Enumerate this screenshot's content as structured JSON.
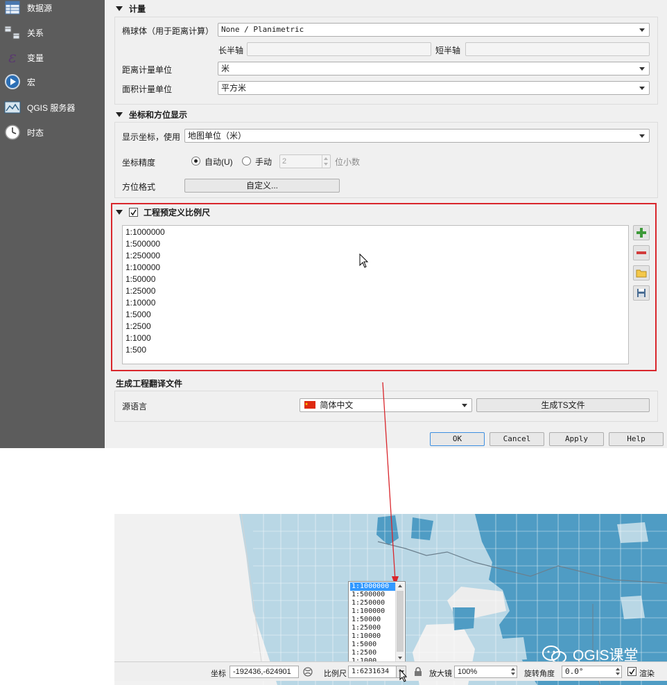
{
  "sidebar": {
    "items": [
      {
        "label": "数据源",
        "icon": "table-icon"
      },
      {
        "label": "关系",
        "icon": "relations-icon"
      },
      {
        "label": "变量",
        "icon": "variable-icon"
      },
      {
        "label": "宏",
        "icon": "macro-icon"
      },
      {
        "label": "QGIS 服务器",
        "icon": "server-icon"
      },
      {
        "label": "时态",
        "icon": "clock-icon"
      }
    ]
  },
  "measurements": {
    "title": "计量",
    "ellipsoid_label": "椭球体（用于距离计算）",
    "ellipsoid_value": "None / Planimetric",
    "semi_major_label": "长半轴",
    "semi_minor_label": "短半轴",
    "distance_units_label": "距离计量单位",
    "distance_units_value": "米",
    "area_units_label": "面积计量单位",
    "area_units_value": "平方米"
  },
  "coordinates": {
    "title": "坐标和方位显示",
    "display_label": "显示坐标，使用",
    "display_value": "地图单位（米）",
    "precision_label": "坐标精度",
    "auto_label": "自动(U)",
    "manual_label": "手动",
    "precision_value": "2",
    "decimals_label": "位小数",
    "bearing_label": "方位格式",
    "bearing_button": "自定义..."
  },
  "scales": {
    "title": "工程预定义比例尺",
    "checked": true,
    "items": [
      "1:1000000",
      "1:500000",
      "1:250000",
      "1:100000",
      "1:50000",
      "1:25000",
      "1:10000",
      "1:5000",
      "1:2500",
      "1:1000",
      "1:500"
    ]
  },
  "translation": {
    "title": "生成工程翻译文件",
    "source_label": "源语言",
    "source_value": "简体中文",
    "generate_button": "生成TS文件"
  },
  "buttons": {
    "ok": "OK",
    "cancel": "Cancel",
    "apply": "Apply",
    "help": "Help"
  },
  "statusbar": {
    "coord_label": "坐标",
    "coord_value": "-192436,-624901",
    "scale_label": "比例尺",
    "scale_value": "1:6231634",
    "magnifier_label": "放大镜",
    "magnifier_value": "100%",
    "rotation_label": "旋转角度",
    "rotation_value": "0.0°",
    "render_label": "渲染",
    "render_checked": true
  },
  "dropdown": {
    "items": [
      "1:1000000",
      "1:500000",
      "1:250000",
      "1:100000",
      "1:50000",
      "1:25000",
      "1:10000",
      "1:5000",
      "1:2500",
      "1:1000"
    ],
    "selected": "1:1000000"
  },
  "watermark": "QGIS课堂",
  "colors": {
    "highlight_border": "#d9262c",
    "arrow": "#d9262c",
    "selection": "#3399ff",
    "map_dark": "#4f9cc4",
    "map_light": "#b7d6e4"
  }
}
